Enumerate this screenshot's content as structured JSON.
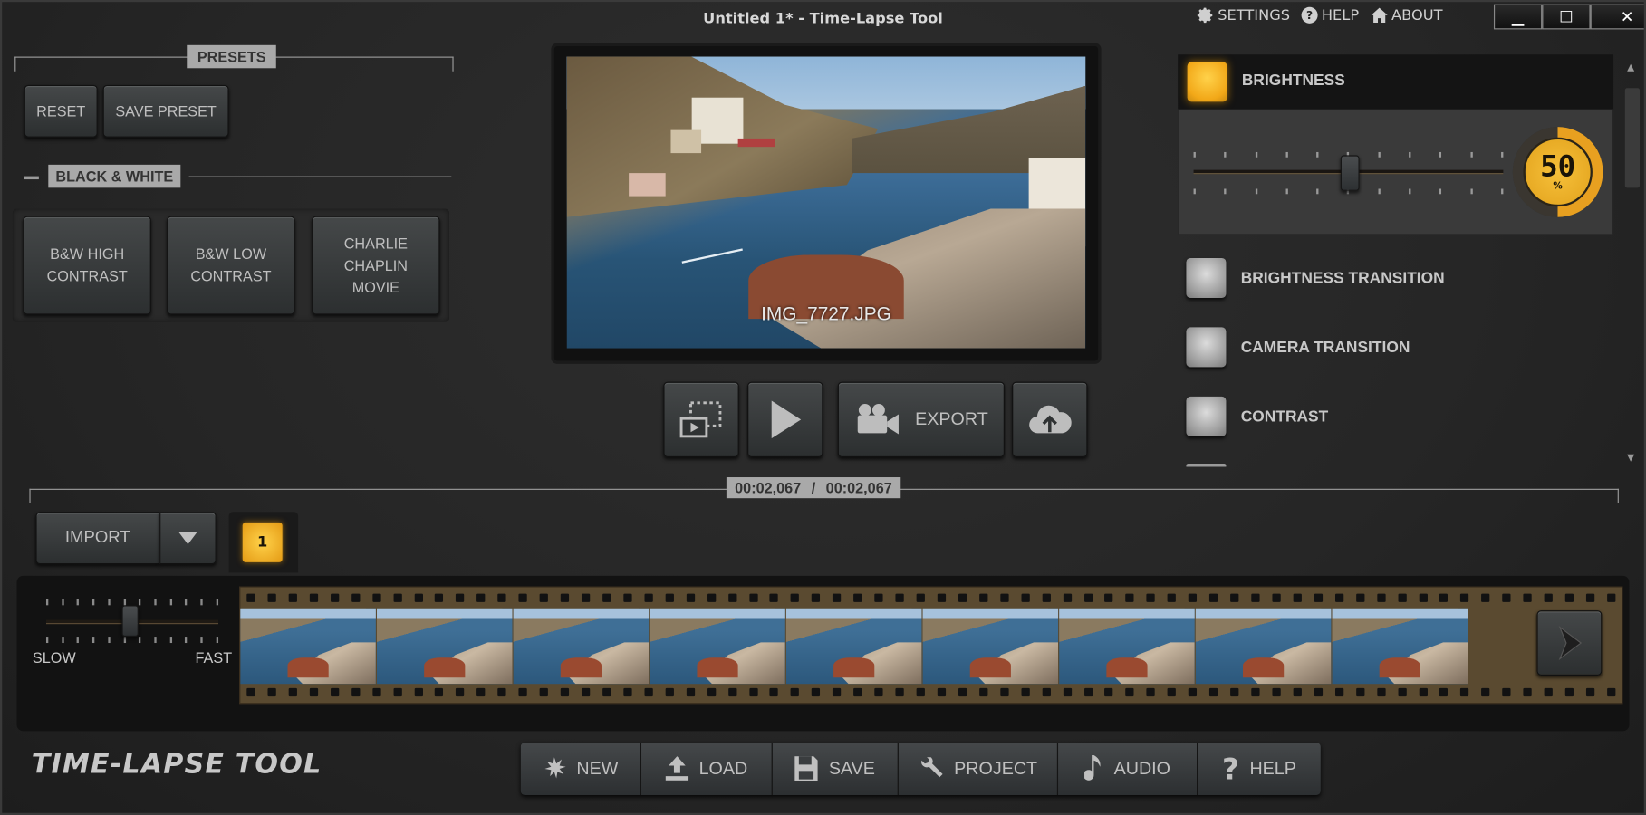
{
  "window": {
    "title": "Untitled 1* - Time-Lapse Tool",
    "menu": [
      {
        "icon": "gear-icon",
        "label": "SETTINGS"
      },
      {
        "icon": "question-circle-icon",
        "label": "HELP"
      },
      {
        "icon": "home-icon",
        "label": "ABOUT"
      }
    ],
    "controls": {
      "minimize": "▁",
      "maximize": "☐",
      "close": "✕"
    }
  },
  "presets": {
    "title": "PRESETS",
    "reset_label": "RESET",
    "save_preset_label": "SAVE PRESET",
    "group": {
      "collapse_symbol": "−",
      "title": "BLACK & WHITE",
      "items": [
        {
          "label": "B&W HIGH CONTRAST"
        },
        {
          "label": "B&W LOW CONTRAST"
        },
        {
          "label": "CHARLIE CHAPLIN MOVIE"
        }
      ]
    }
  },
  "preview": {
    "filename": "IMG_7727.JPG",
    "buttons": {
      "export_label": "EXPORT"
    }
  },
  "effects": {
    "brightness": {
      "label": "BRIGHTNESS",
      "enabled": true,
      "value": 50,
      "unit": "%",
      "slider_fraction": 0.5
    },
    "items": [
      {
        "label": "BRIGHTNESS TRANSITION",
        "enabled": false
      },
      {
        "label": "CAMERA TRANSITION",
        "enabled": false
      },
      {
        "label": "CONTRAST",
        "enabled": false
      }
    ]
  },
  "timecode": {
    "current": "00:02,067",
    "separator": "/",
    "total": "00:02,067"
  },
  "timeline": {
    "import_label": "IMPORT",
    "tab_number": "1",
    "speed": {
      "slow_label": "SLOW",
      "fast_label": "FAST",
      "fraction": 0.48
    },
    "frame_count": 9
  },
  "footer": {
    "logo": "TIME-LAPSE TOOL",
    "buttons": [
      {
        "icon": "starburst-icon",
        "label": "NEW"
      },
      {
        "icon": "upload-icon",
        "label": "LOAD"
      },
      {
        "icon": "floppy-disk-icon",
        "label": "SAVE"
      },
      {
        "icon": "wrench-icon",
        "label": "PROJECT"
      },
      {
        "icon": "music-note-icon",
        "label": "AUDIO"
      },
      {
        "icon": "question-mark-icon",
        "label": "HELP"
      }
    ]
  },
  "colors": {
    "accent": "#F2A818",
    "panel": "#262626",
    "label_bg": "#A9A9A9"
  }
}
